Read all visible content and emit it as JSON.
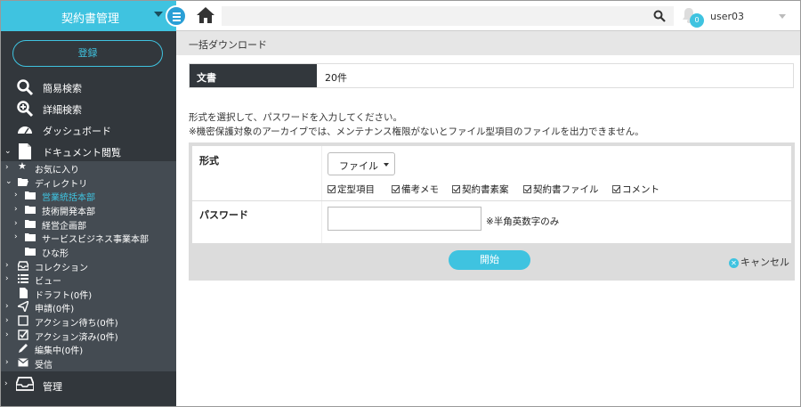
{
  "header": {
    "app_title": "契約書管理",
    "notification_count": "0",
    "username": "user03",
    "accent_color": "#3fc3e0"
  },
  "sidebar": {
    "register_label": "登録",
    "items": [
      {
        "label": "簡易検索",
        "icon": "search-icon"
      },
      {
        "label": "詳細検索",
        "icon": "zoom-plus-icon"
      },
      {
        "label": "ダッシュボード",
        "icon": "dashboard-icon"
      }
    ],
    "doc_browse_label": "ドキュメント閲覧",
    "tree": [
      {
        "label": "お気に入り",
        "icon": "star-icon"
      },
      {
        "label": "ディレクトリ",
        "icon": "folder-open-icon"
      },
      {
        "label": "営業統括本部",
        "icon": "folder-icon"
      },
      {
        "label": "技術開発本部",
        "icon": "folder-icon"
      },
      {
        "label": "経営企画部",
        "icon": "folder-icon"
      },
      {
        "label": "サービスビジネス事業本部",
        "icon": "folder-icon"
      },
      {
        "label": "ひな形",
        "icon": "folder-icon"
      },
      {
        "label": "コレクション",
        "icon": "inbox-icon"
      },
      {
        "label": "ビュー",
        "icon": "list-icon"
      },
      {
        "label": "ドラフト(0件)",
        "icon": "file-icon"
      },
      {
        "label": "申請(0件)",
        "icon": "send-icon"
      },
      {
        "label": "アクション待ち(0件)",
        "icon": "checkbox-empty-icon"
      },
      {
        "label": "アクション済み(0件)",
        "icon": "checkbox-checked-icon"
      },
      {
        "label": "編集中(0件)",
        "icon": "pencil-icon"
      },
      {
        "label": "受信",
        "icon": "mail-icon"
      }
    ],
    "admin_label": "管理"
  },
  "main": {
    "page_title": "一括ダウンロード",
    "summary_label": "文書",
    "summary_value": "20件",
    "info_line1": "形式を選択して、パスワードを入力してください。",
    "info_line2": "※機密保護対象のアーカイブでは、メンテナンス権限がないとファイル型項目のファイルを出力できません。",
    "format_label": "形式",
    "format_selected": "ファイル",
    "checkboxes": [
      "定型項目",
      "備考メモ",
      "契約書素案",
      "契約書ファイル",
      "コメント"
    ],
    "password_label": "パスワード",
    "password_value": "",
    "password_note": "※半角英数字のみ",
    "start_label": "開始",
    "cancel_label": "キャンセル"
  }
}
